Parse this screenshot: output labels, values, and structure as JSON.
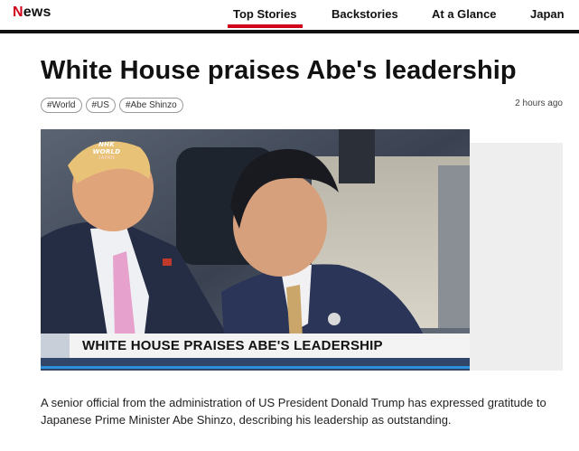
{
  "brand": {
    "first_letter": "N",
    "rest": "ews"
  },
  "nav": {
    "items": [
      {
        "label": "Top Stories",
        "active": true
      },
      {
        "label": "Backstories",
        "active": false
      },
      {
        "label": "At a Glance",
        "active": false
      },
      {
        "label": "Japan",
        "active": false
      }
    ]
  },
  "article": {
    "headline": "White House praises Abe's leadership",
    "tags": [
      "#World",
      "#US",
      "#Abe Shinzo"
    ],
    "timestamp": "2 hours ago",
    "video": {
      "channel_logo": "NHK WORLD",
      "channel_sub": "JAPAN",
      "caption": "WHITE HOUSE PRAISES ABE'S LEADERSHIP"
    },
    "summary": "A senior official from the administration of US President Donald Trump has expressed gratitude to Japanese Prime Minister Abe Shinzo, describing his leadership as outstanding."
  },
  "colors": {
    "brand_red": "#d0021b",
    "rule": "#111111",
    "lower_third_bg": "#f3f3f3",
    "strip_blue": "#32466a"
  }
}
